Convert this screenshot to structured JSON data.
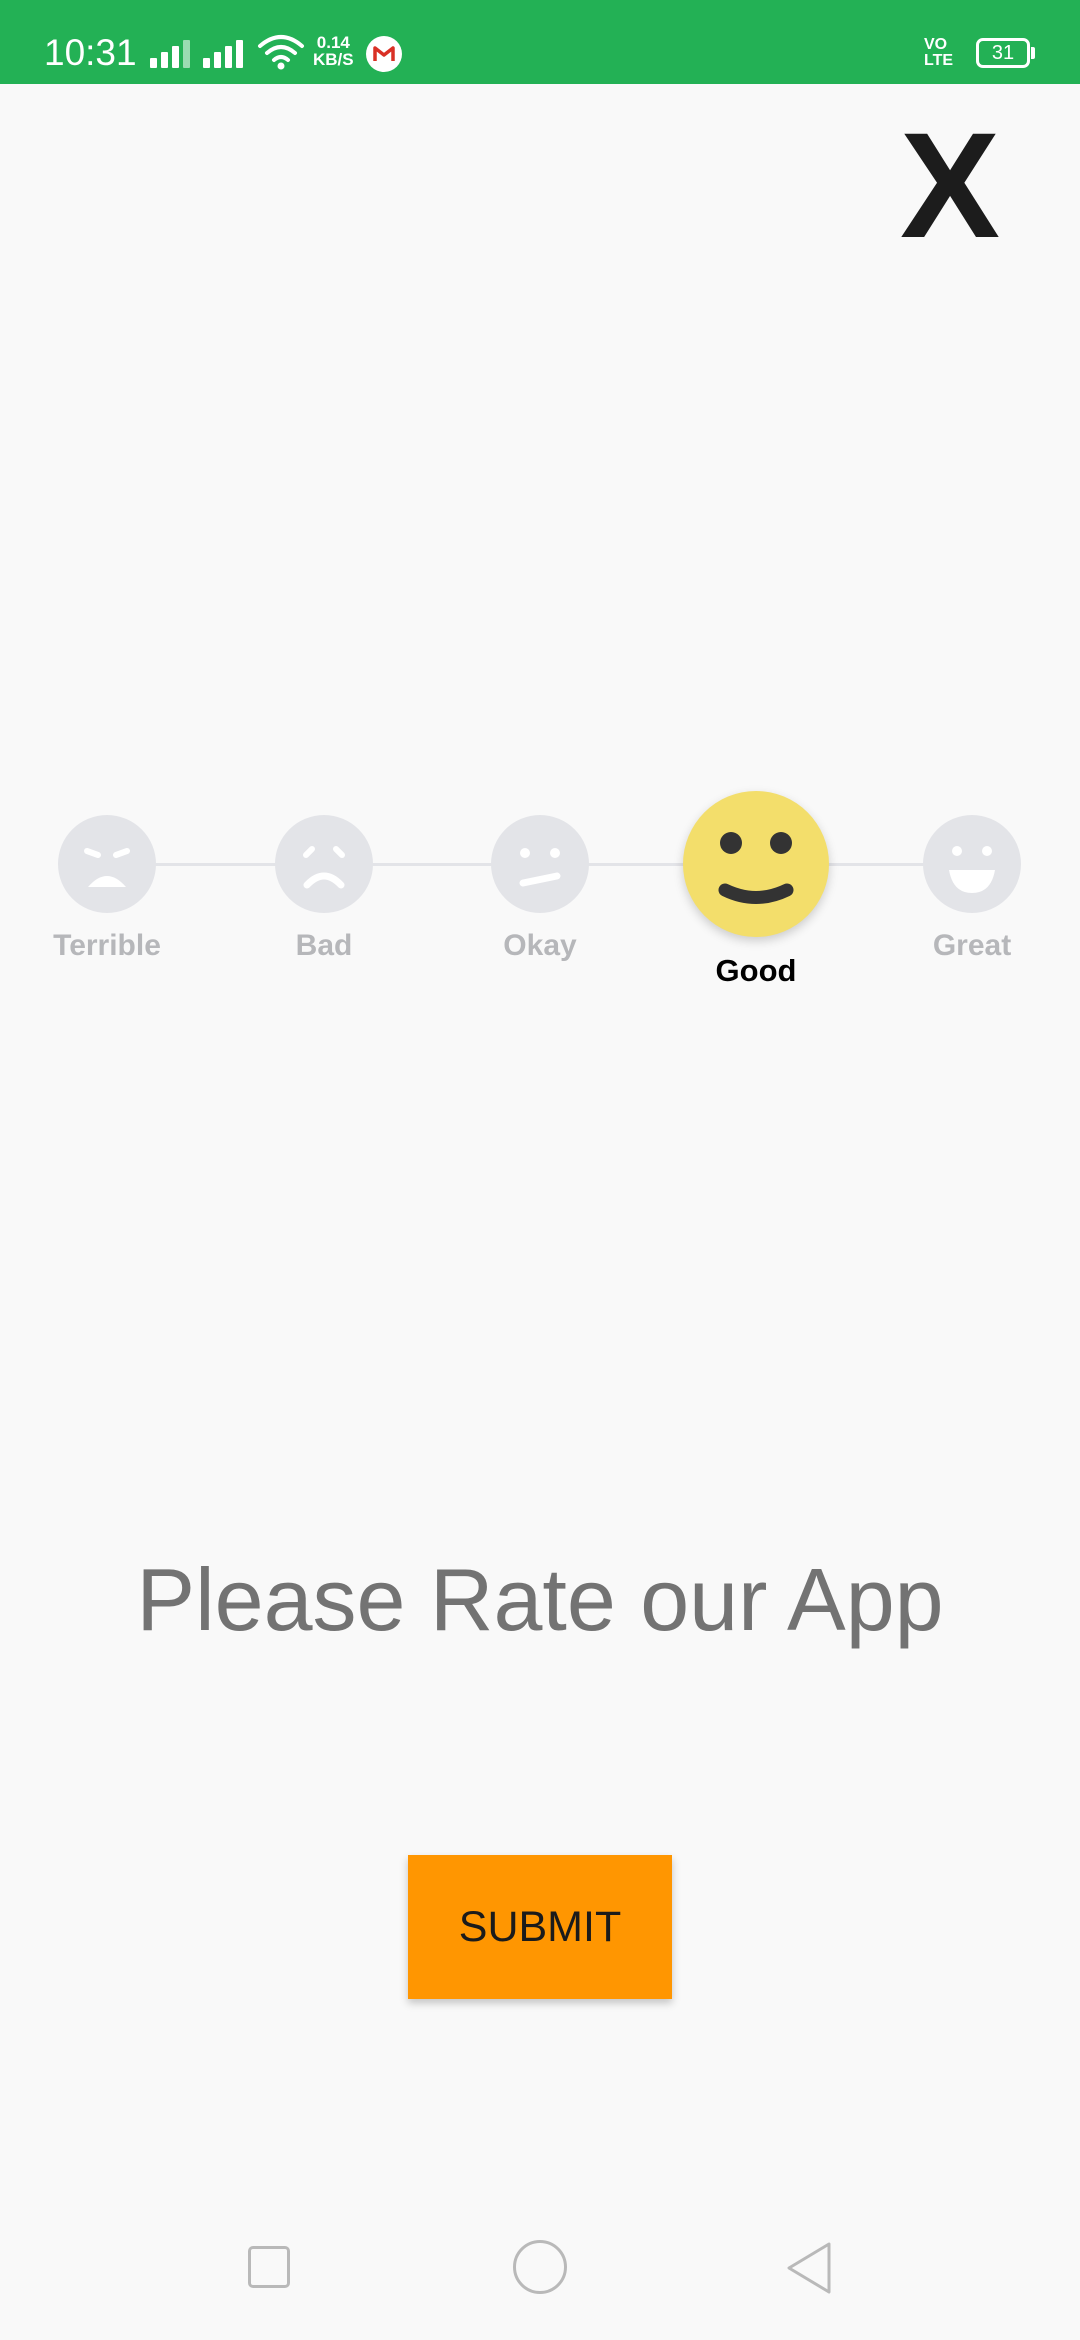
{
  "status_bar": {
    "time": "10:31",
    "net_speed_value": "0.14",
    "net_speed_unit": "KB/S",
    "volte_line1": "VO",
    "volte_line2": "LTE",
    "battery": "31",
    "background_color": "#23b155"
  },
  "close": {
    "label": "X"
  },
  "rating": {
    "options": [
      {
        "label": "Terrible",
        "icon": "terrible-face-icon"
      },
      {
        "label": "Bad",
        "icon": "bad-face-icon"
      },
      {
        "label": "Okay",
        "icon": "okay-face-icon"
      },
      {
        "label": "Good",
        "icon": "good-face-icon"
      },
      {
        "label": "Great",
        "icon": "great-face-icon"
      }
    ],
    "selected": "Good",
    "selected_color": "#f3de6b",
    "unselected_color": "#e3e4e8"
  },
  "prompt": "Please Rate our App",
  "submit": {
    "label": "SUBMIT",
    "color": "#ff9601"
  },
  "nav_bar": {
    "icons": [
      "recents-square-icon",
      "home-circle-icon",
      "back-triangle-icon"
    ]
  }
}
